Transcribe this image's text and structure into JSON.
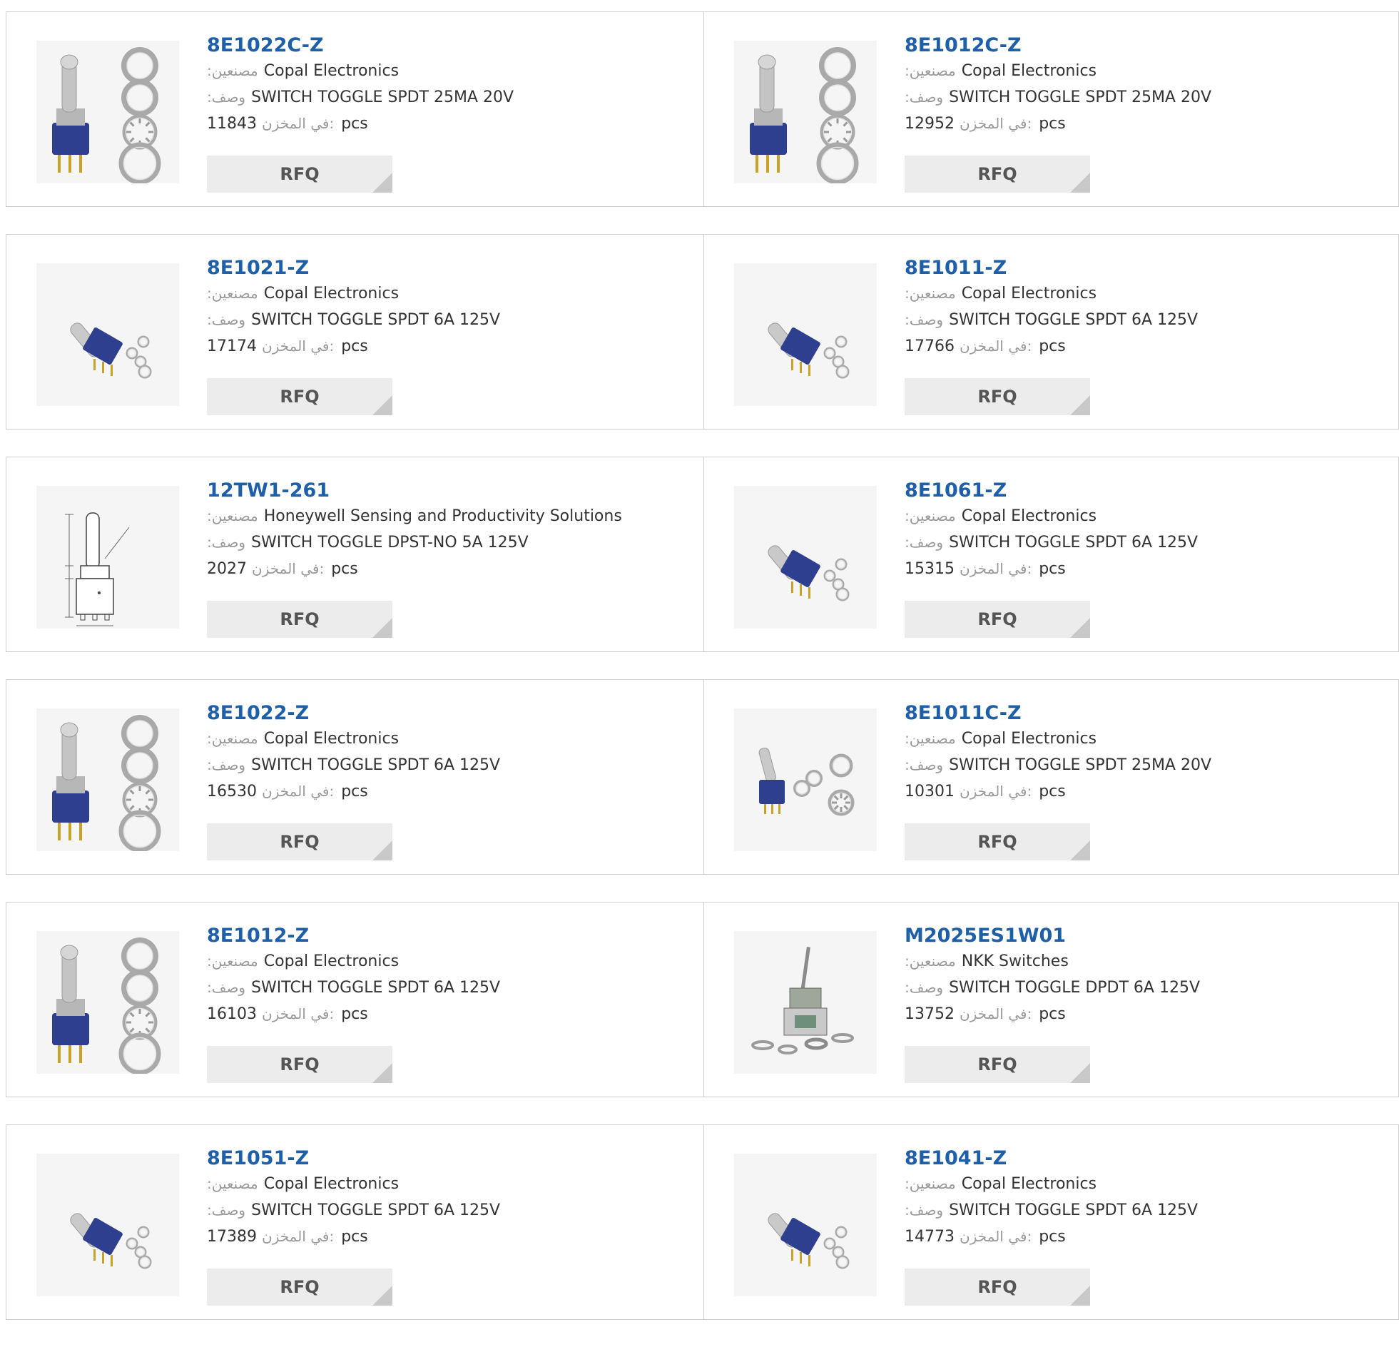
{
  "labels": {
    "manufacturer": ":مصنعين",
    "description": ":وصف",
    "stock": "في المخزن:",
    "unit": "pcs",
    "rfq": "RFQ"
  },
  "colors": {
    "part_link": "#1d5fa8",
    "rfq_bg": "#ececec",
    "rfq_corner": "#c9c9c9",
    "border": "#cfcfcf"
  },
  "products": [
    {
      "part": "8E1022C-Z",
      "manufacturer": "Copal Electronics",
      "description": "SWITCH TOGGLE SPDT 25MA 20V",
      "stock": "11843",
      "image": "switch-upright-with-nuts"
    },
    {
      "part": "8E1012C-Z",
      "manufacturer": "Copal Electronics",
      "description": "SWITCH TOGGLE SPDT 25MA 20V",
      "stock": "12952",
      "image": "switch-upright-with-nuts"
    },
    {
      "part": "8E1021-Z",
      "manufacturer": "Copal Electronics",
      "description": "SWITCH TOGGLE SPDT 6A 125V",
      "stock": "17174",
      "image": "switch-tilted"
    },
    {
      "part": "8E1011-Z",
      "manufacturer": "Copal Electronics",
      "description": "SWITCH TOGGLE SPDT 6A 125V",
      "stock": "17766",
      "image": "switch-tilted"
    },
    {
      "part": "12TW1-261",
      "manufacturer": "Honeywell Sensing and Productivity Solutions",
      "description": "SWITCH TOGGLE DPST-NO 5A 125V",
      "stock": "2027",
      "image": "switch-drawing"
    },
    {
      "part": "8E1061-Z",
      "manufacturer": "Copal Electronics",
      "description": "SWITCH TOGGLE SPDT 6A 125V",
      "stock": "15315",
      "image": "switch-tilted"
    },
    {
      "part": "8E1022-Z",
      "manufacturer": "Copal Electronics",
      "description": "SWITCH TOGGLE SPDT 6A 125V",
      "stock": "16530",
      "image": "switch-upright-with-nuts"
    },
    {
      "part": "8E1011C-Z",
      "manufacturer": "Copal Electronics",
      "description": "SWITCH TOGGLE SPDT 25MA 20V",
      "stock": "10301",
      "image": "switch-tilted-with-nuts"
    },
    {
      "part": "8E1012-Z",
      "manufacturer": "Copal Electronics",
      "description": "SWITCH TOGGLE SPDT 6A 125V",
      "stock": "16103",
      "image": "switch-upright-with-nuts"
    },
    {
      "part": "M2025ES1W01",
      "manufacturer": "NKK Switches",
      "description": "SWITCH TOGGLE DPDT 6A 125V",
      "stock": "13752",
      "image": "switch-nkk"
    },
    {
      "part": "8E1051-Z",
      "manufacturer": "Copal Electronics",
      "description": "SWITCH TOGGLE SPDT 6A 125V",
      "stock": "17389",
      "image": "switch-tilted"
    },
    {
      "part": "8E1041-Z",
      "manufacturer": "Copal Electronics",
      "description": "SWITCH TOGGLE SPDT 6A 125V",
      "stock": "14773",
      "image": "switch-tilted"
    }
  ]
}
